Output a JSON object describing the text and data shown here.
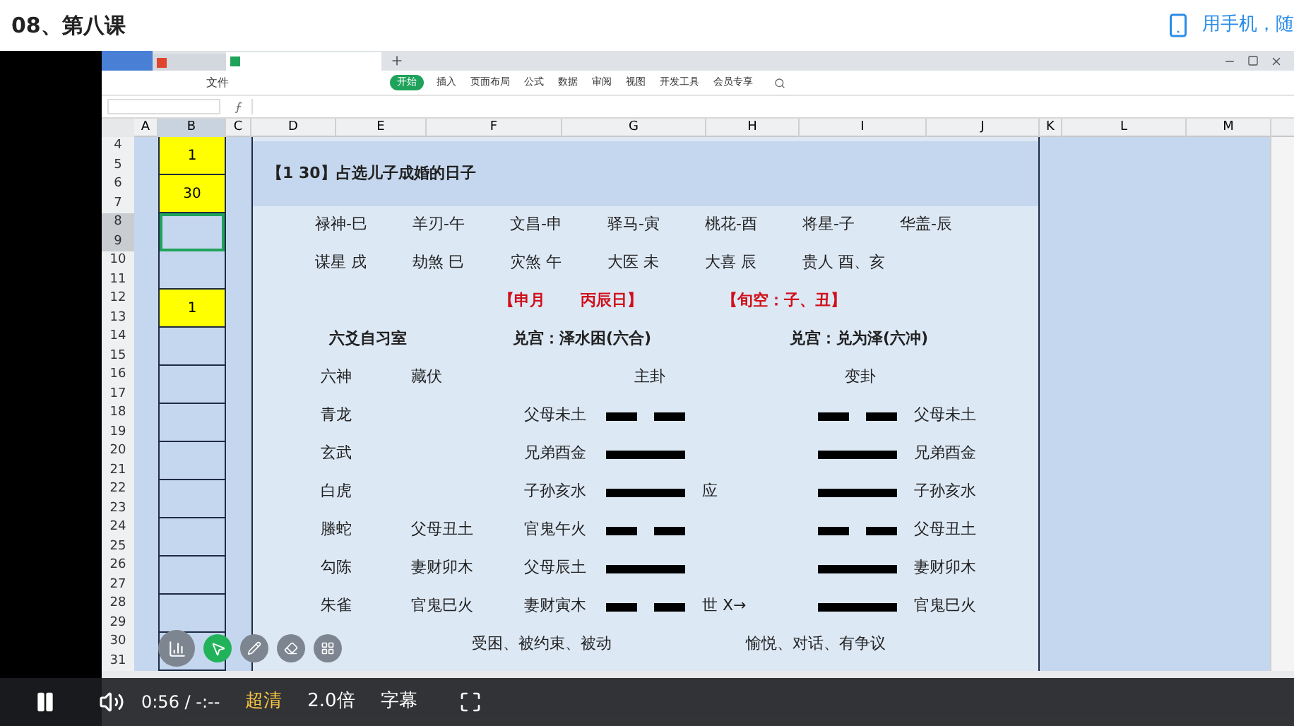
{
  "page_title": "08、第八课",
  "mobile_link": "用手机，随",
  "spreadsheet": {
    "file_menu": "文件",
    "ribbon_tabs": [
      {
        "label": "开始",
        "selected": true
      },
      {
        "label": "插入",
        "selected": false
      },
      {
        "label": "页面布局",
        "selected": false
      },
      {
        "label": "公式",
        "selected": false
      },
      {
        "label": "数据",
        "selected": false
      },
      {
        "label": "审阅",
        "selected": false
      },
      {
        "label": "视图",
        "selected": false
      },
      {
        "label": "开发工具",
        "selected": false
      },
      {
        "label": "会员专享",
        "selected": false
      }
    ],
    "columns": [
      "A",
      "B",
      "C",
      "D",
      "E",
      "F",
      "G",
      "H",
      "I",
      "J",
      "K",
      "L",
      "M"
    ],
    "row_numbers": [
      "4",
      "5",
      "6",
      "7",
      "8",
      "9",
      "10",
      "11",
      "12",
      "13",
      "14",
      "15",
      "16",
      "17",
      "18",
      "19",
      "20",
      "21",
      "22",
      "23",
      "24",
      "25",
      "26",
      "27",
      "28",
      "29",
      "30",
      "31"
    ],
    "column_b_cells": [
      {
        "value": "1",
        "highlighted": true,
        "selected": false
      },
      {
        "value": "30",
        "highlighted": true,
        "selected": false
      },
      {
        "highlighted": false,
        "selected": true
      },
      {
        "highlighted": false,
        "selected": false
      },
      {
        "value": "1",
        "highlighted": true,
        "selected": false
      },
      {
        "highlighted": false,
        "selected": false
      },
      {
        "highlighted": false,
        "selected": false
      },
      {
        "highlighted": false,
        "selected": false
      },
      {
        "highlighted": false,
        "selected": false
      },
      {
        "highlighted": false,
        "selected": false
      },
      {
        "highlighted": false,
        "selected": false
      },
      {
        "highlighted": false,
        "selected": false
      },
      {
        "highlighted": false,
        "selected": false
      },
      {
        "highlighted": false,
        "selected": false
      }
    ],
    "sheet": {
      "title": "【1 30】占选儿子成婚的日子",
      "shensha_rows": [
        [
          "禄神-巳",
          "羊刃-午",
          "文昌-申",
          "驿马-寅",
          "桃花-酉",
          "将星-子",
          "华盖-辰"
        ],
        [
          "谋星 戌",
          "劫煞 巳",
          "灾煞 午",
          "大医 未",
          "大喜 辰",
          "贵人 酉、亥"
        ]
      ],
      "date_line": [
        "【申月",
        "丙辰日】",
        "【旬空：子、丑】"
      ],
      "headers": [
        "六爻自习室",
        "兑宫：泽水困(六合)",
        "兑宫：兑为泽(六冲)"
      ],
      "column_labels": [
        "六神",
        "藏伏",
        "主卦",
        "变卦"
      ],
      "lines": [
        {
          "god": "青龙",
          "main": "父母未土",
          "main_line": {
            "kind": "yin"
          },
          "changed_line": {
            "kind": "yin"
          },
          "changed": "父母未土"
        },
        {
          "god": "玄武",
          "main": "兄弟酉金",
          "main_line": {
            "kind": "yang"
          },
          "changed_line": {
            "kind": "yang"
          },
          "changed": "兄弟酉金"
        },
        {
          "god": "白虎",
          "main": "子孙亥水",
          "main_line": {
            "kind": "yang"
          },
          "marker": "应",
          "changed_line": {
            "kind": "yang"
          },
          "changed": "子孙亥水"
        },
        {
          "god": "螣蛇",
          "hidden": "父母丑土",
          "main": "官鬼午火",
          "main_line": {
            "kind": "yin"
          },
          "changed_line": {
            "kind": "yin"
          },
          "changed": "父母丑土"
        },
        {
          "god": "勾陈",
          "hidden": "妻财卯木",
          "main": "父母辰土",
          "main_line": {
            "kind": "yang"
          },
          "changed_line": {
            "kind": "yang"
          },
          "changed": "妻财卯木"
        },
        {
          "god": "朱雀",
          "hidden": "官鬼巳火",
          "main": "妻财寅木",
          "main_line": {
            "kind": "yin"
          },
          "marker": "世 X→",
          "changed_line": {
            "kind": "yang"
          },
          "changed": "官鬼巳火"
        }
      ],
      "meanings": [
        "受困、被约束、被动",
        "愉悦、对话、有争议"
      ]
    }
  },
  "player": {
    "time": "0:56 / -:--",
    "quality": "超清",
    "speed": "2.0倍",
    "subtitles": "字幕"
  }
}
